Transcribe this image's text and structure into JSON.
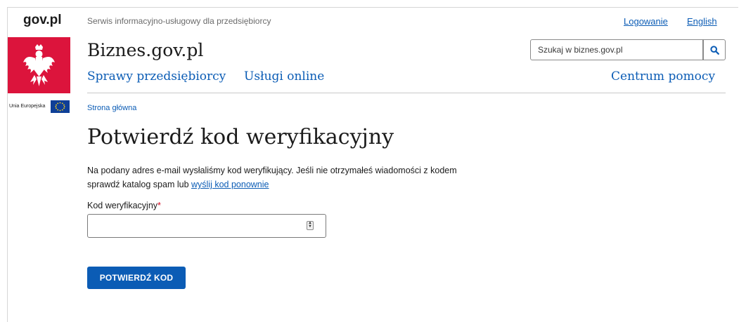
{
  "sidebar": {
    "gov_logo": "gov.pl",
    "eu_label": "Unia Europejska"
  },
  "header": {
    "service_description": "Serwis informacyjno-usługowy dla przedsiębiorcy",
    "login_link": "Logowanie",
    "language_link": "English",
    "site_title": "Biznes.gov.pl",
    "search_placeholder": "Szukaj w biznes.gov.pl"
  },
  "nav": {
    "items": [
      "Sprawy przedsiębiorcy",
      "Usługi online"
    ],
    "help": "Centrum pomocy"
  },
  "breadcrumb": "Strona główna",
  "main": {
    "title": "Potwierdź kod weryfikacyjny",
    "description_part1": "Na podany adres e-mail wysłaliśmy kod weryfikujący. Jeśli nie otrzymałeś wiadomości z kodem sprawdź katalog spam lub ",
    "resend_link": "wyślij kod ponownie",
    "field_label": "Kod weryfikacyjny",
    "required_mark": "*",
    "field_value": "",
    "confirm_button": "POTWIERDŹ KOD"
  },
  "colors": {
    "accent": "#0b5cb5",
    "crest_red": "#dc143c",
    "eu_blue": "#0e3f97",
    "required": "#d0021b"
  }
}
